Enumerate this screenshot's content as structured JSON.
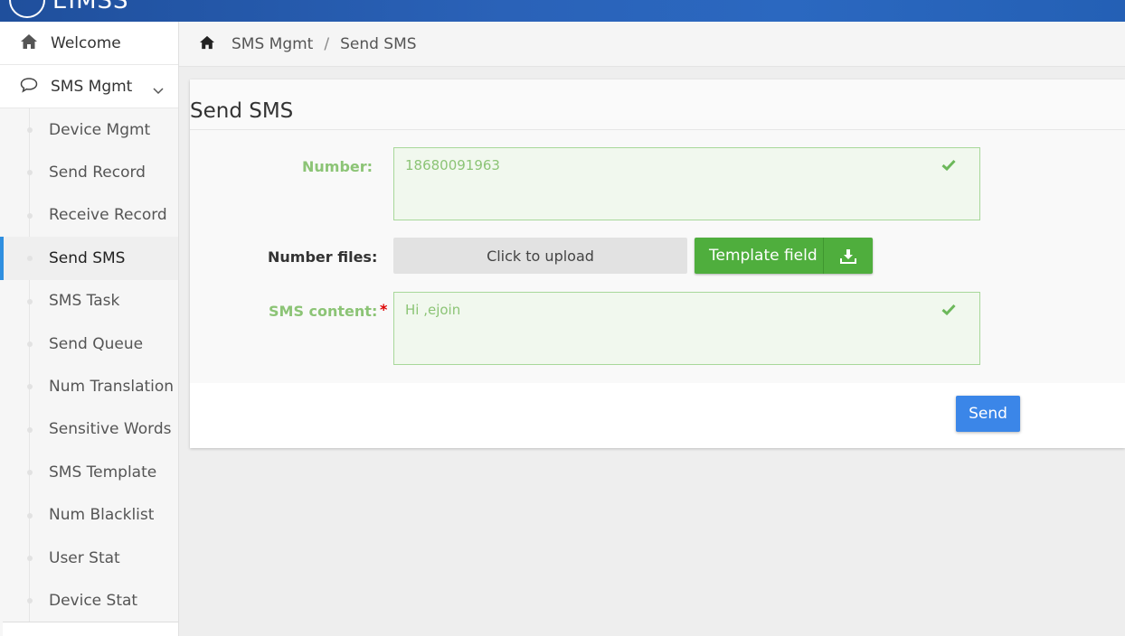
{
  "app": {
    "logo_text": "EIMSS"
  },
  "sidebar": {
    "welcome_label": "Welcome",
    "group_label": "SMS Mgmt",
    "items": [
      {
        "label": "Device Mgmt"
      },
      {
        "label": "Send Record"
      },
      {
        "label": "Receive Record"
      },
      {
        "label": "Send SMS",
        "active": true
      },
      {
        "label": "SMS Task"
      },
      {
        "label": "Send Queue"
      },
      {
        "label": "Num Translation"
      },
      {
        "label": "Sensitive Words"
      },
      {
        "label": "SMS Template"
      },
      {
        "label": "Num Blacklist"
      },
      {
        "label": "User Stat"
      },
      {
        "label": "Device Stat"
      }
    ]
  },
  "breadcrumb": {
    "home_icon": "home-icon",
    "level1": "SMS Mgmt",
    "separator": "/",
    "level2": "Send SMS"
  },
  "form": {
    "title": "Send SMS",
    "number_label": "Number:",
    "number_value": "18680091963",
    "files_label": "Number files:",
    "upload_label": "Click to upload",
    "template_label": "Template field",
    "content_label": "SMS content:",
    "required_mark": "*",
    "content_value": "Hi ,ejoin",
    "send_label": "Send"
  },
  "colors": {
    "accent_blue": "#3b86e8",
    "success_green": "#4fae3d",
    "valid_green": "#8cc476",
    "active_bar": "#2f8fe0"
  }
}
